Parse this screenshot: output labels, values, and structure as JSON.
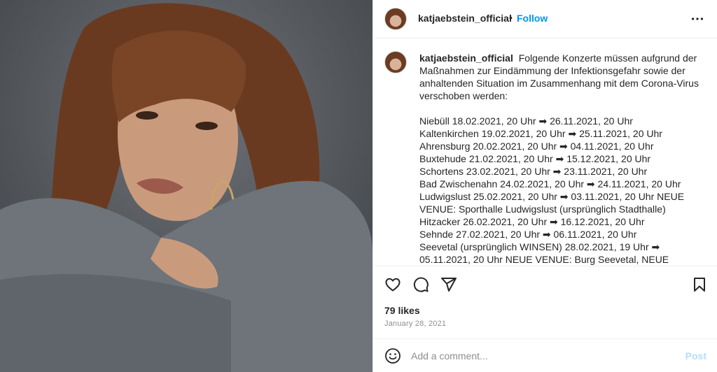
{
  "post": {
    "username": "katjaebstein_official",
    "follow_label": "Follow",
    "separator": "•",
    "caption": {
      "username": "katjaebstein_official",
      "intro": "Folgende Konzerte müssen aufgrund der Maßnahmen zur Eindämmung der Infektionsgefahr sowie der anhaltenden Situation im Zusammenhang mit dem Corona-Virus verschoben werden:",
      "lines": [
        "Niebüll 18.02.2021, 20 Uhr ➡ 26.11.2021, 20 Uhr",
        "Kaltenkirchen 19.02.2021, 20 Uhr ➡ 25.11.2021, 20 Uhr",
        "Ahrensburg 20.02.2021, 20 Uhr ➡ 04.11.2021, 20 Uhr",
        "Buxtehude 21.02.2021, 20 Uhr ➡ 15.12.2021, 20 Uhr",
        "Schortens 23.02.2021, 20 Uhr ➡ 23.11.2021, 20 Uhr",
        "Bad Zwischenahn 24.02.2021, 20 Uhr ➡ 24.11.2021, 20 Uhr",
        "Ludwigslust 25.02.2021, 20 Uhr ➡ 03.11.2021, 20 Uhr NEUE VENUE: Sporthalle Ludwigslust (ursprünglich Stadthalle)",
        "Hitzacker 26.02.2021, 20 Uhr ➡ 16.12.2021, 20 Uhr",
        "Sehnde 27.02.2021, 20 Uhr ➡ 06.11.2021, 20 Uhr",
        "Seevetal (ursprünglich WINSEN) 28.02.2021, 19 Uhr ➡ 05.11.2021, 20 Uhr NEUE VENUE: Burg Seevetal, NEUE UHRZEIT"
      ]
    },
    "likes": "79 likes",
    "date": "January 28, 2021",
    "comment_placeholder": "Add a comment...",
    "post_label": "Post"
  },
  "icons": {
    "more": "more-options-icon",
    "like": "heart-icon",
    "comment": "comment-icon",
    "share": "share-icon",
    "save": "bookmark-icon",
    "emoji": "emoji-icon"
  },
  "colors": {
    "link": "#0095f6",
    "post_disabled": "#b2dffc",
    "muted": "#8e8e8e",
    "text": "#262626"
  }
}
